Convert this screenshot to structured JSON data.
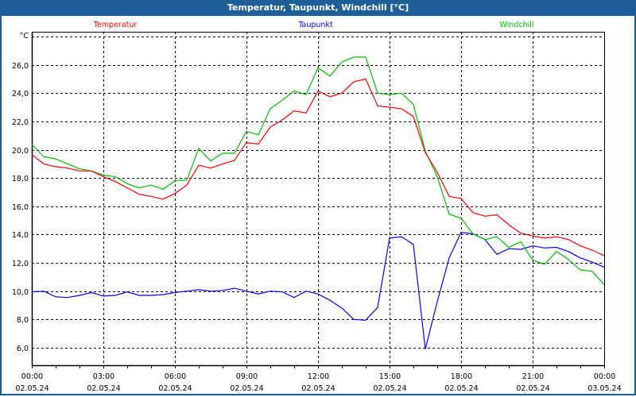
{
  "window": {
    "title": "Temperatur, Taupunkt, Windchill [°C]"
  },
  "chart_data": {
    "type": "line",
    "title": "Temperatur, Taupunkt, Windchill [°C]",
    "ylabel": "°C",
    "ylim": [
      4.76,
      28.34
    ],
    "yticks": [
      6,
      8,
      10,
      12,
      14,
      16,
      18,
      20,
      22,
      24,
      26,
      28
    ],
    "ytick_labels": [
      "6,0",
      "8,0",
      "10,0",
      "12,0",
      "14,0",
      "16,0",
      "18,0",
      "20,0",
      "22,0",
      "24,0",
      "26,0",
      ""
    ],
    "x_hours_range": [
      0,
      24
    ],
    "xticks": [
      {
        "time": "00:00",
        "date": "02.05.24"
      },
      {
        "time": "03:00",
        "date": "02.05.24"
      },
      {
        "time": "06:00",
        "date": "02.05.24"
      },
      {
        "time": "09:00",
        "date": "02.05.24"
      },
      {
        "time": "12:00",
        "date": "02.05.24"
      },
      {
        "time": "15:00",
        "date": "02.05.24"
      },
      {
        "time": "18:00",
        "date": "02.05.24"
      },
      {
        "time": "21:00",
        "date": "02.05.24"
      },
      {
        "time": "00:00",
        "date": "03.05.24"
      }
    ],
    "grid": true,
    "legend_position": "top",
    "x_hours": [
      0,
      0.5,
      1,
      1.5,
      2,
      2.5,
      3,
      3.5,
      4,
      4.5,
      5,
      5.5,
      6,
      6.5,
      7,
      7.5,
      8,
      8.5,
      9,
      9.5,
      10,
      10.5,
      11,
      11.5,
      12,
      12.5,
      13,
      13.5,
      14,
      14.5,
      15,
      15.5,
      16,
      16.5,
      17,
      17.5,
      18,
      18.5,
      19,
      19.5,
      20,
      20.5,
      21,
      21.5,
      22,
      22.5,
      23,
      23.5,
      24
    ],
    "series": [
      {
        "name": "Temperatur",
        "color": "#ff0000",
        "values": [
          19.65,
          19.0,
          18.8,
          18.7,
          18.5,
          18.5,
          18.1,
          17.75,
          17.3,
          16.85,
          16.7,
          16.5,
          16.9,
          17.5,
          18.9,
          18.7,
          19.0,
          19.25,
          20.5,
          20.4,
          21.6,
          22.1,
          22.75,
          22.6,
          24.15,
          23.75,
          24.0,
          24.8,
          25.0,
          23.1,
          23.0,
          22.9,
          22.35,
          19.8,
          18.4,
          16.7,
          16.55,
          15.55,
          15.3,
          15.4,
          14.7,
          14.1,
          13.9,
          13.75,
          13.85,
          13.65,
          13.2,
          12.9,
          12.5
        ]
      },
      {
        "name": "Taupunkt",
        "color": "#0000ff",
        "values": [
          9.95,
          10.0,
          9.6,
          9.55,
          9.7,
          9.9,
          9.65,
          9.7,
          9.95,
          9.7,
          9.7,
          9.75,
          9.9,
          10.0,
          10.1,
          10.0,
          10.05,
          10.2,
          10.0,
          9.8,
          10.0,
          9.95,
          9.55,
          10.0,
          9.8,
          9.35,
          8.8,
          8.0,
          7.95,
          8.85,
          13.75,
          13.85,
          13.3,
          5.9,
          9.25,
          12.35,
          14.15,
          14.05,
          13.65,
          12.6,
          13.0,
          12.95,
          13.2,
          13.05,
          13.1,
          12.8,
          12.35,
          12.05,
          11.7
        ]
      },
      {
        "name": "Windchill",
        "color": "#00c000",
        "values": [
          20.4,
          19.5,
          19.35,
          19.0,
          18.65,
          18.5,
          18.2,
          18.1,
          17.6,
          17.3,
          17.5,
          17.2,
          17.8,
          17.85,
          20.1,
          19.2,
          19.75,
          19.75,
          21.3,
          21.05,
          22.9,
          23.5,
          24.15,
          23.9,
          25.8,
          25.2,
          26.2,
          26.55,
          26.55,
          24.0,
          23.9,
          24.0,
          23.2,
          19.9,
          18.1,
          15.45,
          15.15,
          14.05,
          13.65,
          13.85,
          13.1,
          13.5,
          12.2,
          11.9,
          12.8,
          12.25,
          11.5,
          11.4,
          10.45
        ]
      }
    ]
  }
}
